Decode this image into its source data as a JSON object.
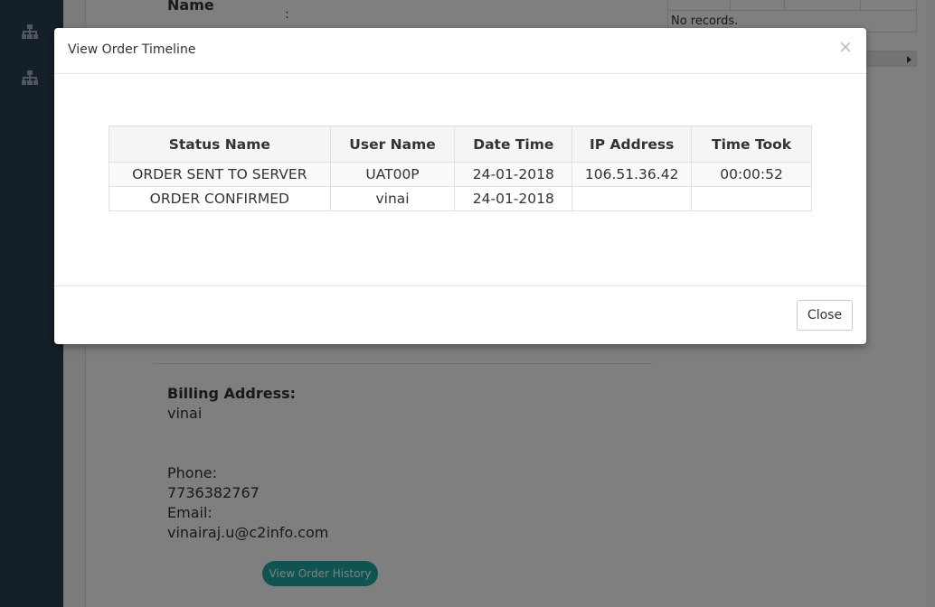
{
  "background": {
    "name_label": "Name",
    "colon": ":",
    "no_records": "No records.",
    "billing_label": "Billing Address:",
    "billing_name": "vinai",
    "phone_label": "Phone:",
    "phone_value": "7736382767",
    "email_label": "Email:",
    "email_value": "vinairaj.u@c2info.com",
    "view_history_button": "View Order History"
  },
  "sidebar": {
    "icons": [
      "sitemap-icon",
      "sitemap-icon"
    ]
  },
  "modal": {
    "title": "View Order Timeline",
    "close_symbol": "×",
    "close_button": "Close",
    "columns": [
      "Status Name",
      "User Name",
      "Date Time",
      "IP Address",
      "Time Took"
    ],
    "rows": [
      [
        "ORDER SENT TO SERVER",
        "UAT00P",
        "24-01-2018",
        "106.51.36.42",
        "00:00:52"
      ],
      [
        "ORDER CONFIRMED",
        "vinai",
        "24-01-2018",
        "",
        ""
      ]
    ]
  },
  "colors": {
    "sidebar": "#2a3f4f",
    "accent": "#1ca8a3"
  }
}
